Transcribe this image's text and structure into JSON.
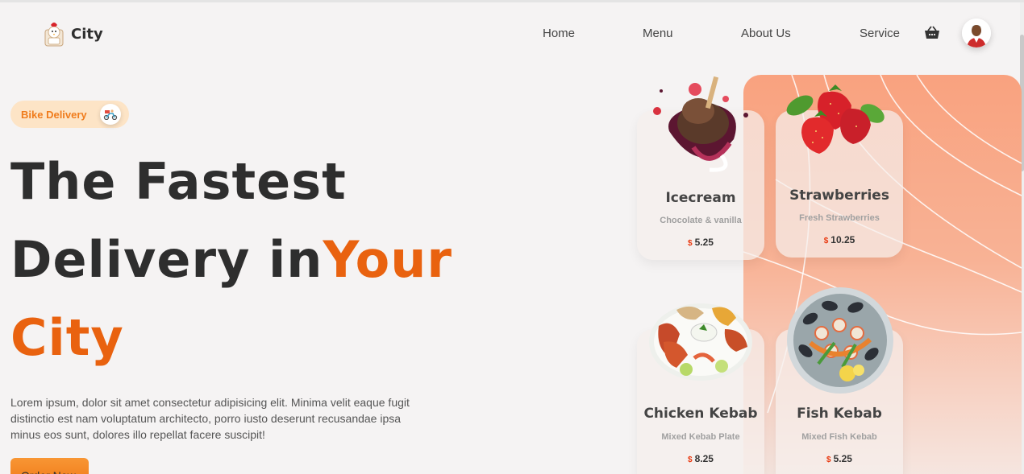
{
  "brand": {
    "name": "City"
  },
  "nav": {
    "items": [
      {
        "label": "Home"
      },
      {
        "label": "Menu"
      },
      {
        "label": "About Us"
      },
      {
        "label": "Service"
      }
    ]
  },
  "hero": {
    "badge_label": "Bike Delivery",
    "line1": "The Fastest",
    "line2_dark": "Delivery in",
    "line2_accent": "Your",
    "line3_accent": "City",
    "description": "Lorem ipsum, dolor sit amet consectetur adipisicing elit. Minima velit eaque fugit distinctio est nam voluptatum architecto, porro iusto deserunt recusandae ipsa minus eos sunt, dolores illo repellat facere suscipit!",
    "cta_label": "Order Now"
  },
  "menu_cards": [
    {
      "title": "Icecream",
      "subtitle": "Chocolate & vanilla",
      "currency": "$",
      "price": "5.25"
    },
    {
      "title": "Strawberries",
      "subtitle": "Fresh Strawberries",
      "currency": "$",
      "price": "10.25"
    },
    {
      "title": "Chicken Kebab",
      "subtitle": "Mixed Kebab Plate",
      "currency": "$",
      "price": "8.25"
    },
    {
      "title": "Fish Kebab",
      "subtitle": "Mixed Fish Kebab",
      "currency": "$",
      "price": "5.25"
    }
  ],
  "colors": {
    "accent": "#e9620f",
    "button": "#f89634",
    "panel": "#f9a27f",
    "price_currency": "#e9380f"
  },
  "icons": {
    "logo": "chef-chicken-logo-icon",
    "cart": "basket-icon",
    "badge": "delivery-scooter-icon"
  }
}
